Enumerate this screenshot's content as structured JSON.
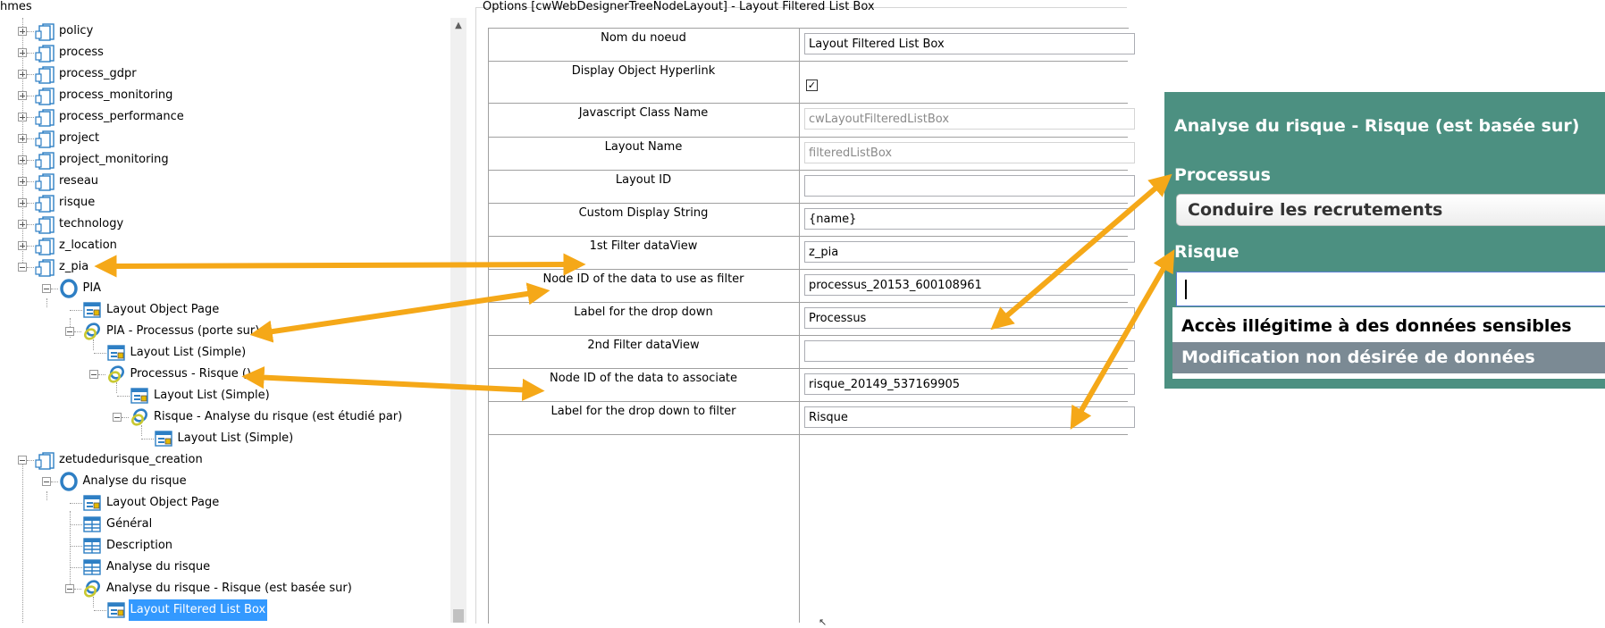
{
  "tree": {
    "header": "hmes",
    "items": [
      {
        "label": "policy",
        "icon": "folder-icon"
      },
      {
        "label": "process",
        "icon": "folder-icon"
      },
      {
        "label": "process_gdpr",
        "icon": "folder-icon"
      },
      {
        "label": "process_monitoring",
        "icon": "folder-icon"
      },
      {
        "label": "process_performance",
        "icon": "folder-icon"
      },
      {
        "label": "project",
        "icon": "folder-icon"
      },
      {
        "label": "project_monitoring",
        "icon": "folder-icon"
      },
      {
        "label": "reseau",
        "icon": "folder-icon"
      },
      {
        "label": "risque",
        "icon": "folder-icon"
      },
      {
        "label": "technology",
        "icon": "folder-icon"
      },
      {
        "label": "z_location",
        "icon": "folder-icon"
      },
      {
        "label": "z_pia",
        "icon": "folder-icon"
      },
      {
        "label": "PIA",
        "icon": "object-ring-icon"
      },
      {
        "label": "Layout Object Page",
        "icon": "layout-page-icon"
      },
      {
        "label": "PIA - Processus (porte sur)",
        "icon": "association-icon"
      },
      {
        "label": "Layout List (Simple)",
        "icon": "layout-page-icon"
      },
      {
        "label": "Processus - Risque ()",
        "icon": "association-icon"
      },
      {
        "label": "Layout List (Simple)",
        "icon": "layout-page-icon"
      },
      {
        "label": "Risque - Analyse du risque (est étudié par)",
        "icon": "association-icon"
      },
      {
        "label": "Layout List (Simple)",
        "icon": "layout-page-icon"
      },
      {
        "label": "zetudedurisque_creation",
        "icon": "folder-icon"
      },
      {
        "label": "Analyse du risque",
        "icon": "object-ring-icon"
      },
      {
        "label": "Layout Object Page",
        "icon": "layout-page-icon"
      },
      {
        "label": "Général",
        "icon": "grid-icon"
      },
      {
        "label": "Description",
        "icon": "grid-icon"
      },
      {
        "label": "Analyse du risque",
        "icon": "grid-icon"
      },
      {
        "label": "Analyse du risque - Risque (est basée sur)",
        "icon": "association-icon"
      },
      {
        "label": "Layout Filtered List Box",
        "icon": "layout-page-icon"
      }
    ]
  },
  "options": {
    "title": "Options [cwWebDesignerTreeNodeLayout] - Layout Filtered List Box",
    "rows": [
      {
        "label": "Nom du noeud",
        "value": "Layout Filtered List Box"
      },
      {
        "label": "Display Object Hyperlink",
        "checked": "✓"
      },
      {
        "label": "Javascript Class Name",
        "value": "cwLayoutFilteredListBox"
      },
      {
        "label": "Layout Name",
        "value": "filteredListBox"
      },
      {
        "label": "Layout ID",
        "value": ""
      },
      {
        "label": "Custom Display String",
        "value": "{name}"
      },
      {
        "label": "1st Filter dataView",
        "value": "z_pia"
      },
      {
        "label": "Node ID of the data to use as filter",
        "value": "processus_20153_600108961"
      },
      {
        "label": "Label for the drop down",
        "value": "Processus"
      },
      {
        "label": "2nd Filter dataView",
        "value": ""
      },
      {
        "label": "Node ID of the data to associate",
        "value": "risque_20149_537169905"
      },
      {
        "label": "Label for the drop down to filter",
        "value": "Risque"
      }
    ]
  },
  "widget": {
    "title": "Analyse du risque - Risque (est basée sur)",
    "processus_label": "Processus",
    "processus_value": "Conduire les recrutements",
    "risque_label": "Risque",
    "risque_input": "",
    "dropdown_items": [
      "Accès illégitime à des données sensibles",
      "Modification non désirée de données"
    ],
    "background_color": "#4c9081",
    "highlight_color": "#7b8a94"
  },
  "annotations": {
    "arrow_color": "#f5a818"
  }
}
